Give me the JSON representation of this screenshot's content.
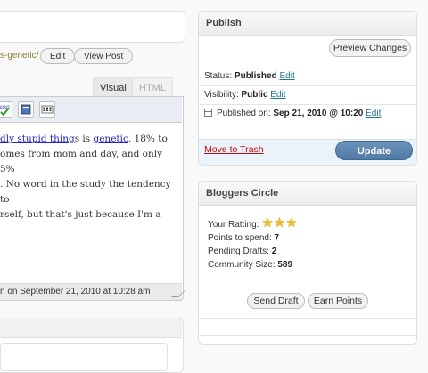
{
  "editor": {
    "permalink_slug": "s-genetic/",
    "edit_permalink_label": "Edit",
    "view_post_label": "View Post",
    "tab_visual": "Visual",
    "tab_html": "HTML",
    "content": {
      "link1": "dly stupid thing",
      "text1": "s is ",
      "link2": "genetic",
      "text2": ".  18% to",
      "line2": "omes from mom and day, and only 5%",
      "line3": ".  No word in the study the tendency to",
      "line4": "rself, but that's just because I'm a"
    },
    "last_edited": "n on September 21, 2010 at 10:28 am"
  },
  "publish": {
    "title": "Publish",
    "preview_label": "Preview Changes",
    "status_label": "Status:",
    "status_value": "Published",
    "visibility_label": "Visibility:",
    "visibility_value": "Public",
    "published_on_label": "Published on:",
    "published_on_value": "Sep 21, 2010 @ 10:20",
    "edit_label": "Edit",
    "trash_label": "Move to Trash",
    "update_label": "Update"
  },
  "bloggers_circle": {
    "title": "Bloggers Circle",
    "rating_label": "Your Ratting:",
    "rating_stars": 3,
    "points_label": "Points to spend:",
    "points_value": "7",
    "pending_label": "Pending Drafts:",
    "pending_value": "2",
    "community_label": "Community Size:",
    "community_value": "589",
    "send_draft_label": "Send Draft",
    "earn_points_label": "Earn Points"
  },
  "colors": {
    "accent": "#21759b",
    "update_button": "#5a84b0",
    "trash": "#bc0b0b",
    "star": "#f0b92a"
  }
}
